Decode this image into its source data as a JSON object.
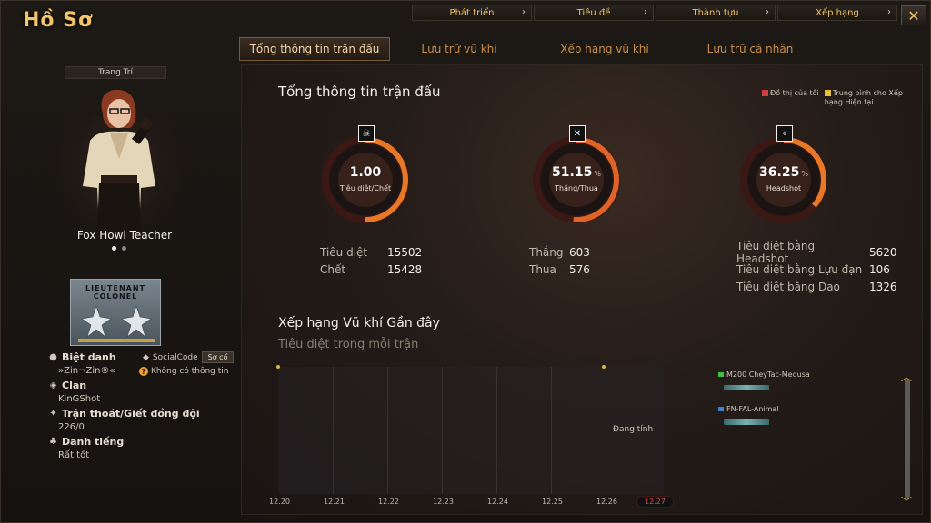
{
  "window": {
    "title": "Hồ Sơ",
    "close_label": "✕"
  },
  "top_nav": [
    {
      "label": "Phát triển"
    },
    {
      "label": "Tiêu đề"
    },
    {
      "label": "Thành tựu"
    },
    {
      "label": "Xếp hạng"
    }
  ],
  "sub_tabs": [
    {
      "label": "Tổng thông tin trận đấu",
      "active": true
    },
    {
      "label": "Lưu trữ vũ khí",
      "active": false
    },
    {
      "label": "Xếp hạng vũ khí",
      "active": false
    },
    {
      "label": "Lưu trữ cá nhân",
      "active": false
    }
  ],
  "profile": {
    "decor_button": "Trang Trí",
    "character_name": "Fox Howl Teacher",
    "rank_text_1": "LIEUTENANT",
    "rank_text_2": "COLONEL",
    "nickname_label": "Biệt danh",
    "nickname_value": "»Zin¬Zin®«",
    "social_code_label": "SocialCode",
    "social_code_button": "Sơ cố",
    "no_info": "Không có thông tin",
    "clan_label": "Clan",
    "clan_value": "KinGShot",
    "escape_label": "Trận thoát/Giết đồng đội",
    "escape_value": "226/0",
    "reputation_label": "Danh tiếng",
    "reputation_value": "Rất tốt"
  },
  "overview": {
    "title": "Tổng thông tin trận đấu",
    "legend_mine": "Đồ thị của tôi",
    "legend_avg": "Trung bình cho Xếp hạng Hiện tại",
    "legend_colors": {
      "mine": "#d04040",
      "avg": "#e8c040"
    },
    "gauges": [
      {
        "value": "1.00",
        "unit": "",
        "label": "Tiêu diệt/Chết",
        "icon": "skull-icon",
        "fraction": 0.5
      },
      {
        "value": "51.15",
        "unit": "%",
        "label": "Thắng/Thua",
        "icon": "crossed-guns-icon",
        "fraction": 0.5115
      },
      {
        "value": "36.25",
        "unit": "%",
        "label": "Headshot",
        "icon": "sniper-icon",
        "fraction": 0.3625
      }
    ],
    "stats_kd": [
      {
        "key": "Tiêu diệt",
        "value": "15502"
      },
      {
        "key": "Chết",
        "value": "15428"
      }
    ],
    "stats_wl": [
      {
        "key": "Thắng",
        "value": "603"
      },
      {
        "key": "Thua",
        "value": "576"
      }
    ],
    "stats_hs": [
      {
        "key": "Tiêu diệt bằng Headshot",
        "value": "5620"
      },
      {
        "key": "Tiêu diệt bằng Lựu đạn",
        "value": "106"
      },
      {
        "key": "Tiêu diệt bằng Dao",
        "value": "1326"
      }
    ]
  },
  "weapon_rank": {
    "title": "Xếp hạng Vũ khí Gần đây",
    "subtitle": "Tiêu diệt trong mỗi trận",
    "calculating": "Đang tính",
    "dates": [
      "12.20",
      "12.21",
      "12.22",
      "12.23",
      "12.24",
      "12.25",
      "12.26",
      "12.27"
    ],
    "active_date": "12.27",
    "legend": [
      {
        "name": "M200 CheyTac-Medusa",
        "color": "#40c040"
      },
      {
        "name": "FN-FAL-Animal",
        "color": "#4080d0"
      }
    ]
  }
}
